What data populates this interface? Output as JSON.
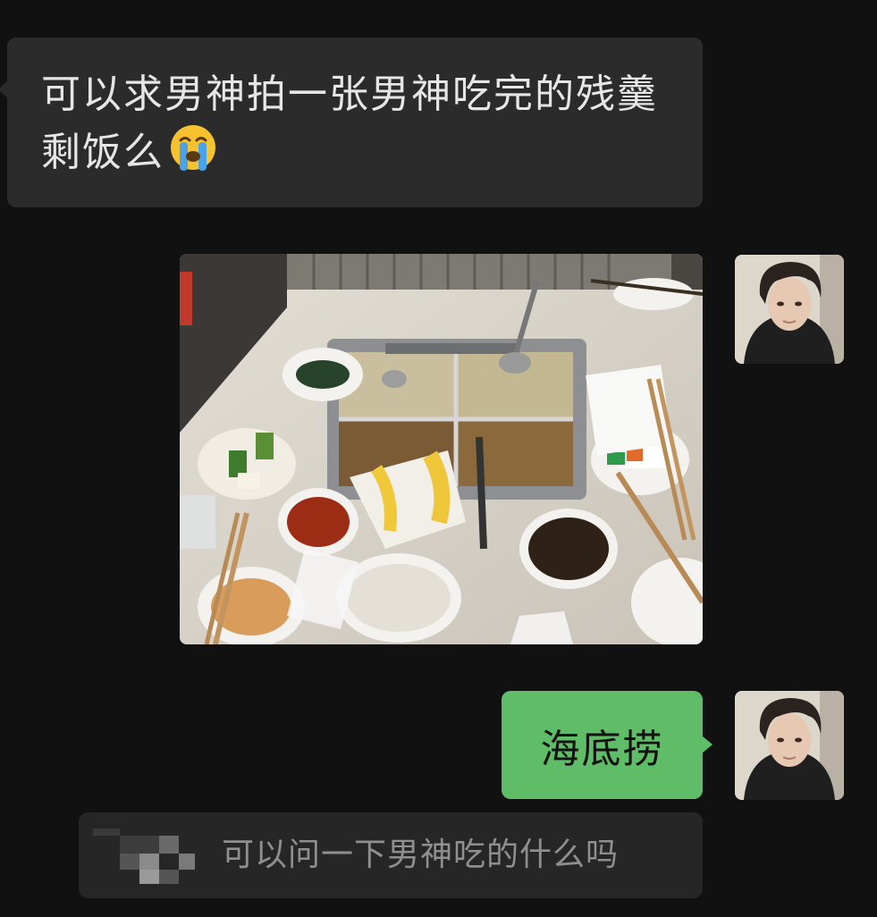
{
  "messages": {
    "incoming_text": "可以求男神拍一张男神吃完的残羹剩饭么",
    "incoming_emoji": "loudly-crying-face-emoji",
    "photo_subject": "hotpot-table-leftovers-photo",
    "outgoing_text": "海底捞",
    "quoted_text": "可以问一下男神吃的什么吗"
  },
  "colors": {
    "background": "#111111",
    "incoming_bubble": "#2b2b2b",
    "outgoing_bubble": "#5fbd67",
    "quote_bar": "#262626"
  }
}
